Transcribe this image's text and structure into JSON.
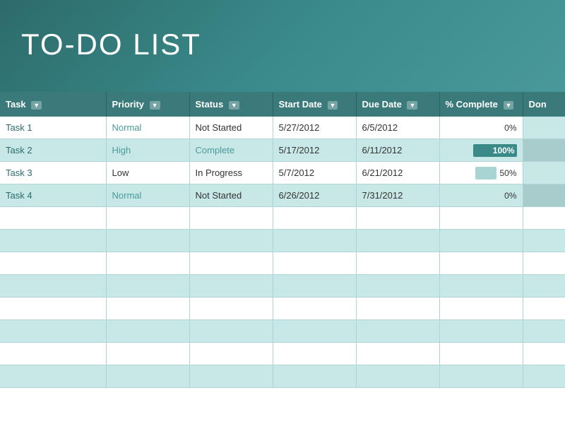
{
  "header": {
    "title": "TO-DO LIST"
  },
  "table": {
    "columns": [
      {
        "id": "task",
        "label": "Task",
        "hasDropdown": true
      },
      {
        "id": "priority",
        "label": "Priority",
        "hasDropdown": true
      },
      {
        "id": "status",
        "label": "Status",
        "hasDropdown": true
      },
      {
        "id": "startDate",
        "label": "Start Date",
        "hasDropdown": true
      },
      {
        "id": "dueDate",
        "label": "Due Date",
        "hasDropdown": true
      },
      {
        "id": "pctComplete",
        "label": "% Complete",
        "hasDropdown": true
      },
      {
        "id": "done",
        "label": "Don",
        "hasDropdown": false
      }
    ],
    "rows": [
      {
        "task": "Task 1",
        "priority": "Normal",
        "priorityClass": "priority-normal",
        "status": "Not Started",
        "statusClass": "status-not-started",
        "startDate": "5/27/2012",
        "dueDate": "6/5/2012",
        "pctComplete": "0%",
        "pctValue": 0
      },
      {
        "task": "Task 2",
        "priority": "High",
        "priorityClass": "priority-high",
        "status": "Complete",
        "statusClass": "status-complete",
        "startDate": "5/17/2012",
        "dueDate": "6/11/2012",
        "pctComplete": "100%",
        "pctValue": 100
      },
      {
        "task": "Task 3",
        "priority": "Low",
        "priorityClass": "priority-low",
        "status": "In Progress",
        "statusClass": "status-in-progress",
        "startDate": "5/7/2012",
        "dueDate": "6/21/2012",
        "pctComplete": "50%",
        "pctValue": 50
      },
      {
        "task": "Task 4",
        "priority": "Normal",
        "priorityClass": "priority-normal",
        "status": "Not Started",
        "statusClass": "status-not-started",
        "startDate": "6/26/2012",
        "dueDate": "7/31/2012",
        "pctComplete": "0%",
        "pctValue": 0
      }
    ],
    "emptyRows": 8
  }
}
